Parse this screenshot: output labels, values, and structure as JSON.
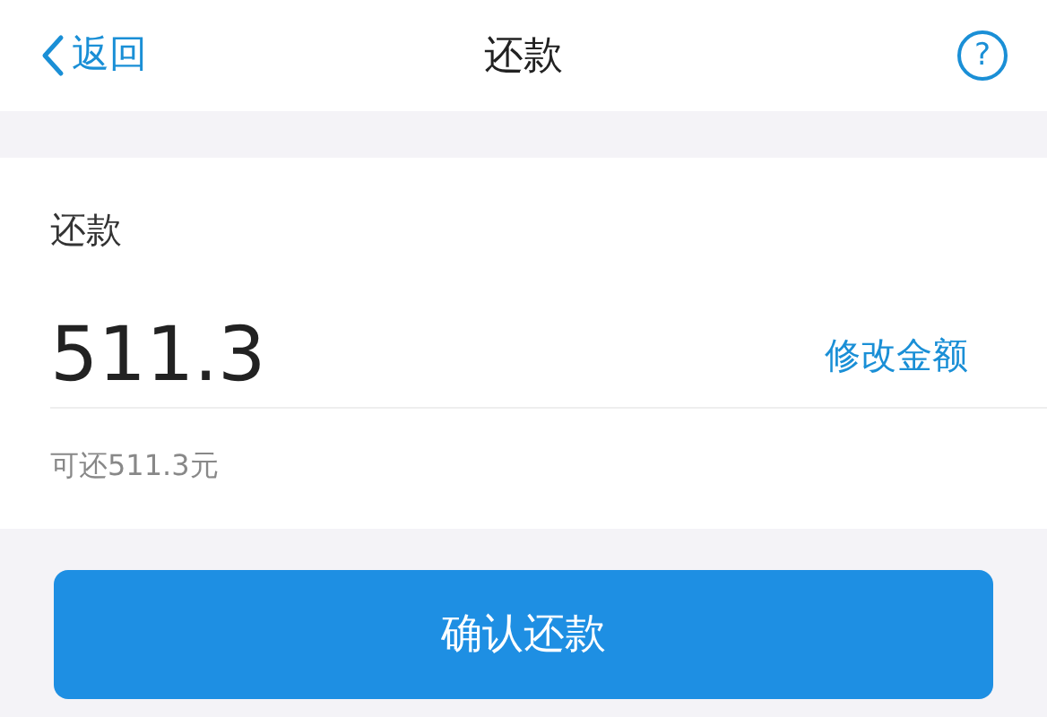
{
  "nav": {
    "back": "返回",
    "title": "还款",
    "help": "?"
  },
  "repay": {
    "label": "还款",
    "amount": "511.3",
    "edit_link": "修改金额",
    "available": "可还511.3元"
  },
  "confirm_button": "确认还款"
}
